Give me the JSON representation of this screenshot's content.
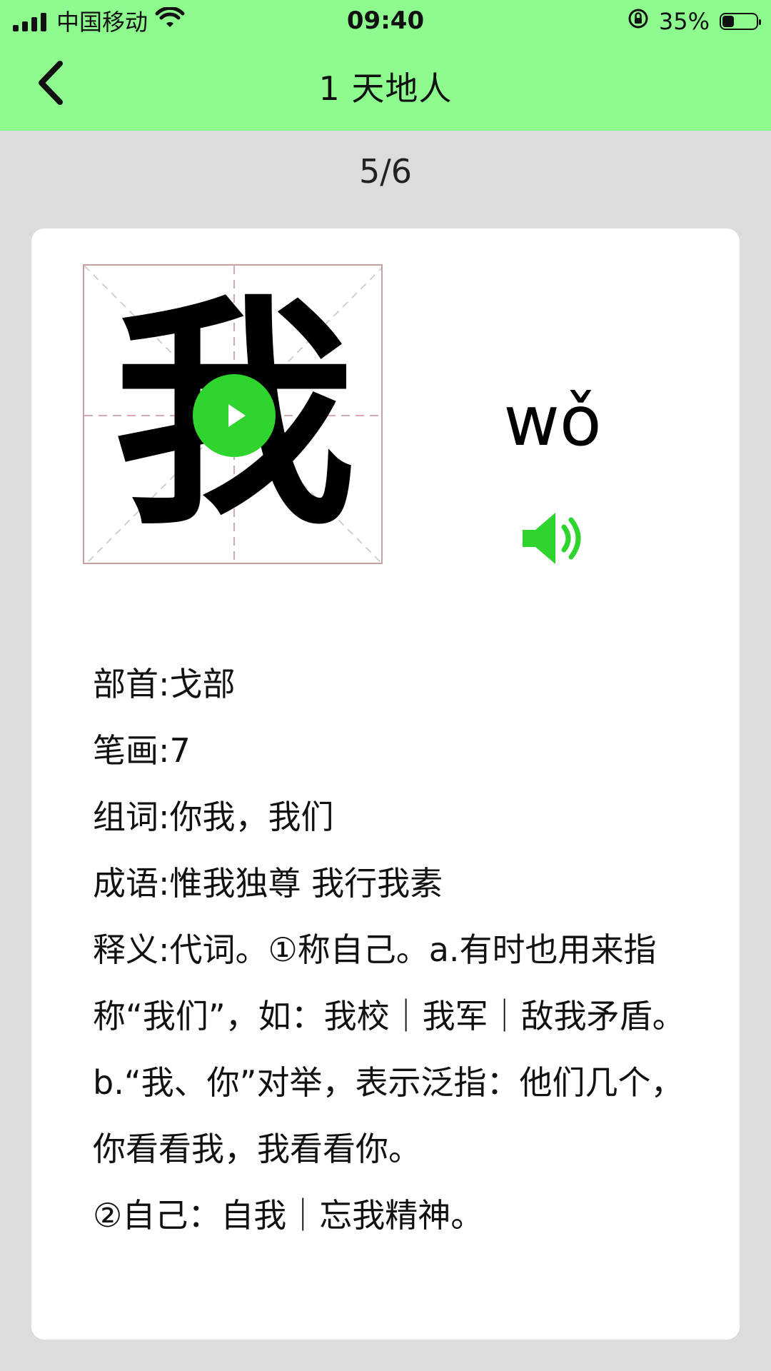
{
  "status_bar": {
    "carrier": "中国移动",
    "time": "09:40",
    "battery_percent": "35%",
    "battery_level": 0.35
  },
  "nav": {
    "title": "1 天地人"
  },
  "pager": {
    "text": "5/6"
  },
  "character": {
    "glyph": "我",
    "pinyin": "wǒ"
  },
  "details": {
    "radical": "部首:戈部",
    "strokes": "笔画:7",
    "words": "组词:你我，我们",
    "idioms": "成语:惟我独尊 我行我素",
    "definition_1": "释义:代词。①称自己。a.有时也用来指称“我们”，如：我校｜我军｜敌我矛盾。b.“我、你”对举，表示泛指：他们几个，你看看我，我看看你。",
    "definition_2": "②自己：自我｜忘我精神。"
  },
  "colors": {
    "nav_bg": "#8dfb8d",
    "accent_green": "#2fd42f",
    "page_bg": "#dcdcdc"
  },
  "icons": {
    "back": "chevron-left-icon",
    "wifi": "wifi-icon",
    "signal": "signal-icon",
    "rotation_lock": "rotation-lock-icon",
    "battery": "battery-icon",
    "play": "play-icon",
    "speaker": "speaker-icon"
  }
}
